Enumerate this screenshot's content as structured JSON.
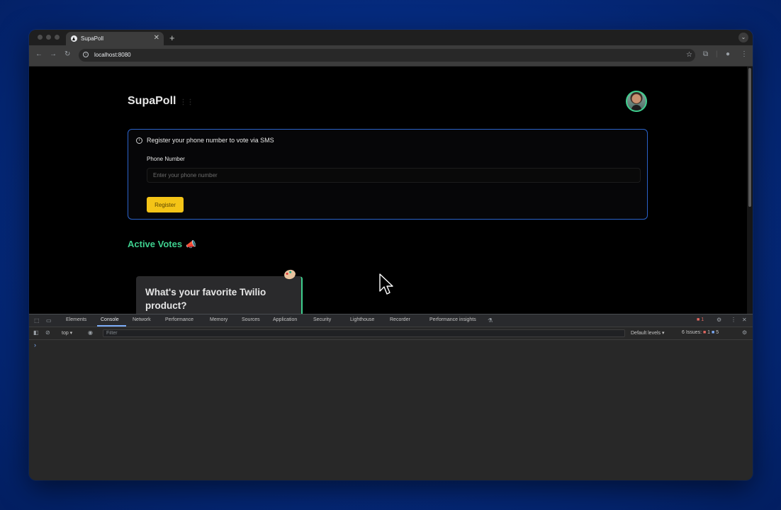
{
  "browser": {
    "tab_title": "SupaPoll",
    "url": "localhost:8080",
    "new_tab_symbol": "+",
    "close_symbol": "✕"
  },
  "page": {
    "app_title": "SupaPoll",
    "title_glyph": "⋮⋮",
    "register": {
      "heading": "Register your phone number to vote via SMS",
      "phone_label": "Phone Number",
      "phone_placeholder": "Enter your phone number",
      "phone_value": "",
      "button_label": "Register"
    },
    "active_votes_heading": "Active Votes",
    "megaphone_emoji": "📣",
    "poll_question": "What's your favorite Twilio product?"
  },
  "devtools": {
    "tabs": [
      "Elements",
      "Console",
      "Network",
      "Performance",
      "Memory",
      "Sources",
      "Application",
      "Security",
      "Lighthouse",
      "Recorder",
      "Performance insights"
    ],
    "active_tab": "Console",
    "error_badge": "1",
    "context": "top",
    "filter_placeholder": "Filter",
    "levels_label": "Default levels",
    "issues_label": "6 Issues:",
    "issues_errors": "1",
    "issues_info": "5",
    "prompt": "›"
  },
  "colors": {
    "accent_green": "#3ecf8e",
    "register_button": "#f4c417",
    "card_border": "#2a62c9",
    "desktop_blue": "#052a7d"
  },
  "icons": [
    "info-icon",
    "star-icon",
    "extensions-icon",
    "profile-icon",
    "gear-icon",
    "close-icon",
    "clear-console-icon",
    "eye-icon",
    "megaphone-icon",
    "palette-icon",
    "cursor-icon"
  ]
}
